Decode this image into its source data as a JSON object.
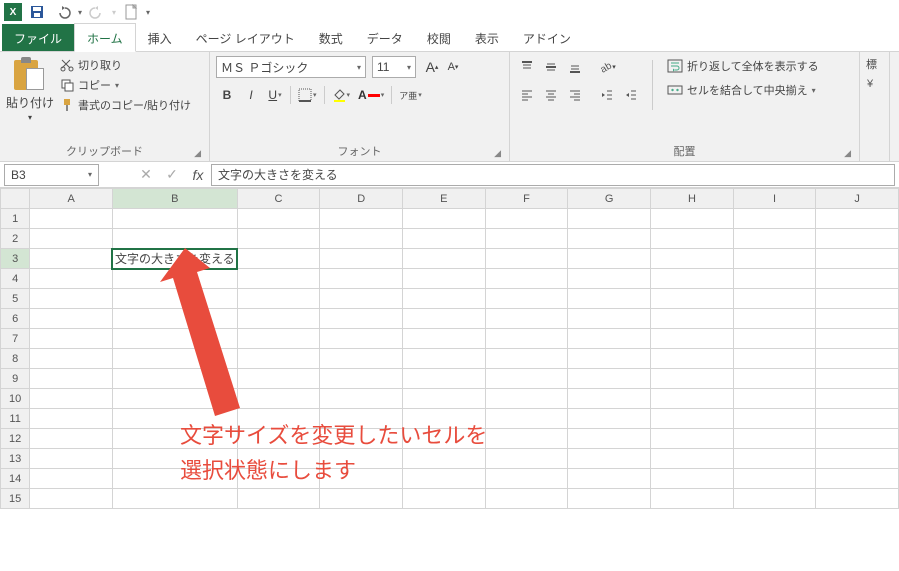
{
  "qat": {
    "app": "X"
  },
  "tabs": {
    "file": "ファイル",
    "home": "ホーム",
    "insert": "挿入",
    "pagelayout": "ページ レイアウト",
    "formulas": "数式",
    "data": "データ",
    "review": "校閲",
    "view": "表示",
    "addin": "アドイン"
  },
  "ribbon": {
    "clipboard": {
      "paste": "貼り付け",
      "cut": "切り取り",
      "copy": "コピー",
      "formatpainter": "書式のコピー/貼り付け",
      "label": "クリップボード"
    },
    "font": {
      "name": "ＭＳ Ｐゴシック",
      "size": "11",
      "bold": "B",
      "italic": "I",
      "underline": "U",
      "ruby": "ア亜",
      "label": "フォント"
    },
    "alignment": {
      "wrap": "折り返して全体を表示する",
      "merge": "セルを結合して中央揃え",
      "label": "配置"
    },
    "number": {
      "std": "標"
    }
  },
  "formula_bar": {
    "namebox": "B3",
    "fx": "fx",
    "value": "文字の大きさを変える"
  },
  "grid": {
    "cols": [
      "A",
      "B",
      "C",
      "D",
      "E",
      "F",
      "G",
      "H",
      "I",
      "J"
    ],
    "rows": [
      1,
      2,
      3,
      4,
      5,
      6,
      7,
      8,
      9,
      10,
      11,
      12,
      13,
      14,
      15
    ],
    "b3": "文字の大きさを変える"
  },
  "annotation": {
    "line1": "文字サイズを変更したいセルを",
    "line2": "選択状態にします"
  }
}
